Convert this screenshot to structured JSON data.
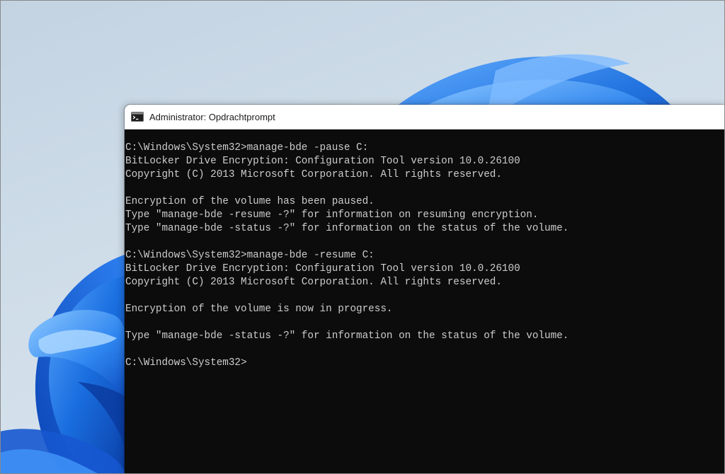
{
  "window": {
    "title": "Administrator: Opdrachtprompt",
    "icon": "cmd-icon"
  },
  "console": {
    "lines": [
      "C:\\Windows\\System32>manage-bde -pause C:",
      "BitLocker Drive Encryption: Configuration Tool version 10.0.26100",
      "Copyright (C) 2013 Microsoft Corporation. All rights reserved.",
      "",
      "Encryption of the volume has been paused.",
      "Type \"manage-bde -resume -?\" for information on resuming encryption.",
      "Type \"manage-bde -status -?\" for information on the status of the volume.",
      "",
      "C:\\Windows\\System32>manage-bde -resume C:",
      "BitLocker Drive Encryption: Configuration Tool version 10.0.26100",
      "Copyright (C) 2013 Microsoft Corporation. All rights reserved.",
      "",
      "Encryption of the volume is now in progress.",
      "",
      "Type \"manage-bde -status -?\" for information on the status of the volume.",
      "",
      "C:\\Windows\\System32>"
    ],
    "text_color": "#cccccc",
    "background_color": "#0c0c0c"
  },
  "desktop": {
    "wallpaper": "windows-11-bloom",
    "accent_color": "#1a6fe0"
  }
}
